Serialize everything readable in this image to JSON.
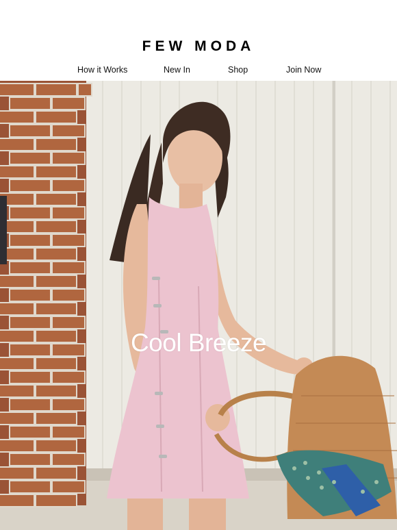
{
  "brand": {
    "name": "FEW MODA",
    "colors": {
      "text": "#111111",
      "background": "#ffffff",
      "headline": "#ffffff"
    }
  },
  "nav": {
    "items": [
      {
        "label": "How it Works"
      },
      {
        "label": "New In"
      },
      {
        "label": "Shop"
      },
      {
        "label": "Join Now"
      }
    ]
  },
  "hero": {
    "headline": "Cool Breeze"
  }
}
